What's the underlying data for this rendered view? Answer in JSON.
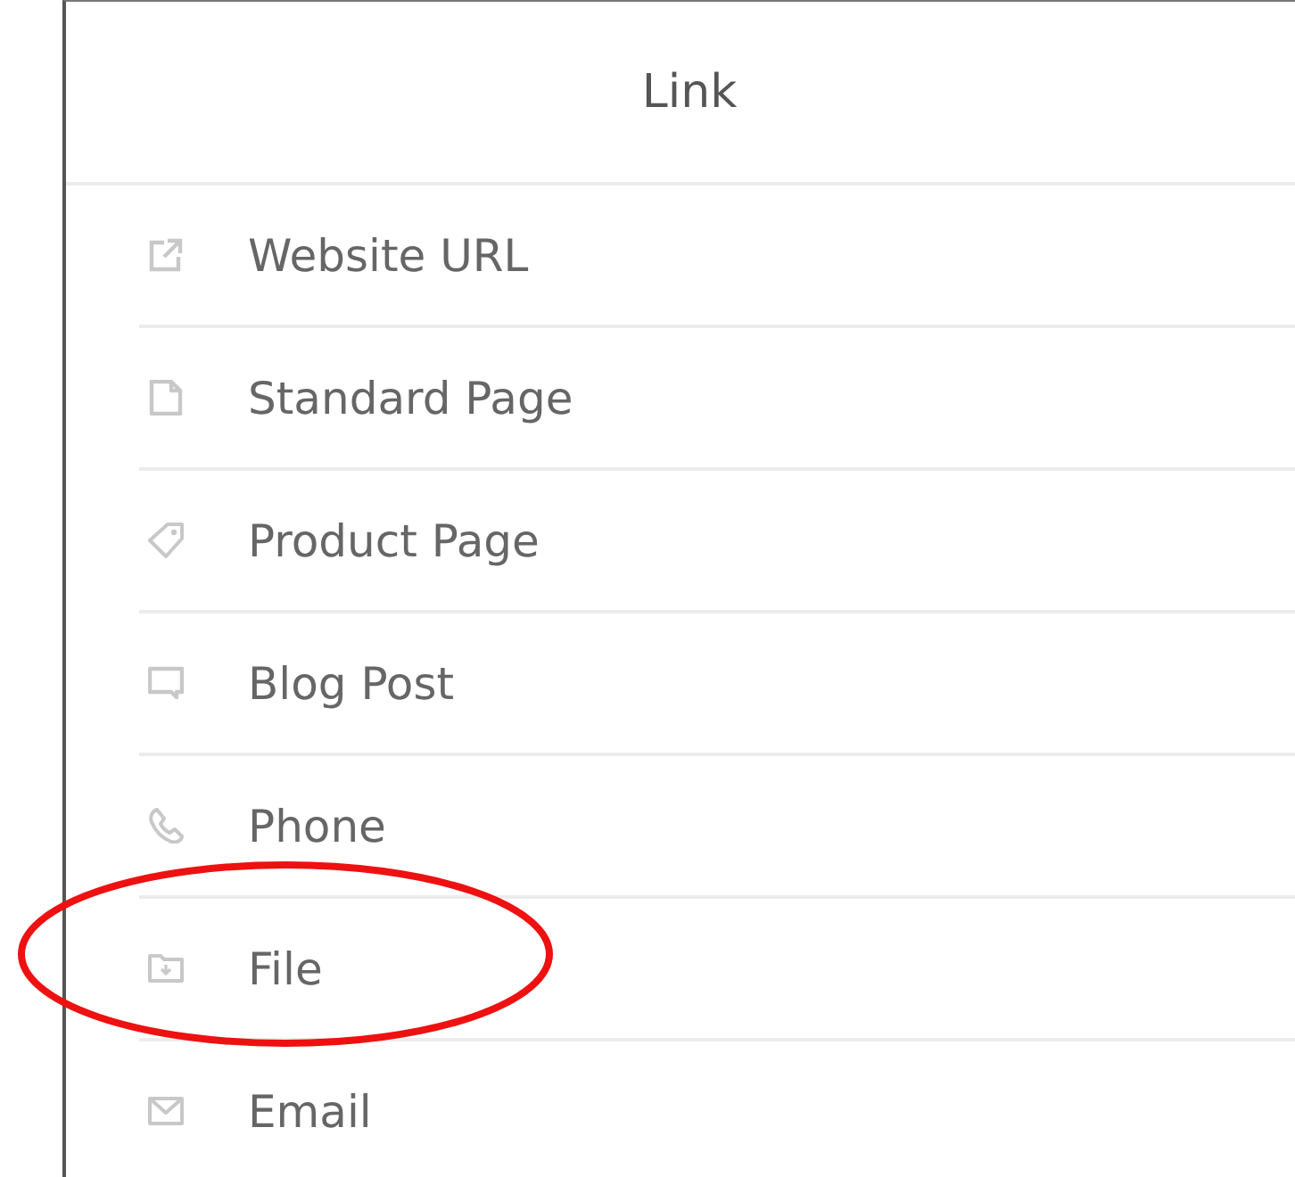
{
  "panel": {
    "title": "Link"
  },
  "items": [
    {
      "kind": "url",
      "label": "Website URL",
      "highlighted": false
    },
    {
      "kind": "page",
      "label": "Standard Page",
      "highlighted": false
    },
    {
      "kind": "product",
      "label": "Product Page",
      "highlighted": false
    },
    {
      "kind": "blog",
      "label": "Blog Post",
      "highlighted": false
    },
    {
      "kind": "phone",
      "label": "Phone",
      "highlighted": false
    },
    {
      "kind": "file",
      "label": "File",
      "highlighted": true
    },
    {
      "kind": "email",
      "label": "Email",
      "highlighted": false
    }
  ]
}
